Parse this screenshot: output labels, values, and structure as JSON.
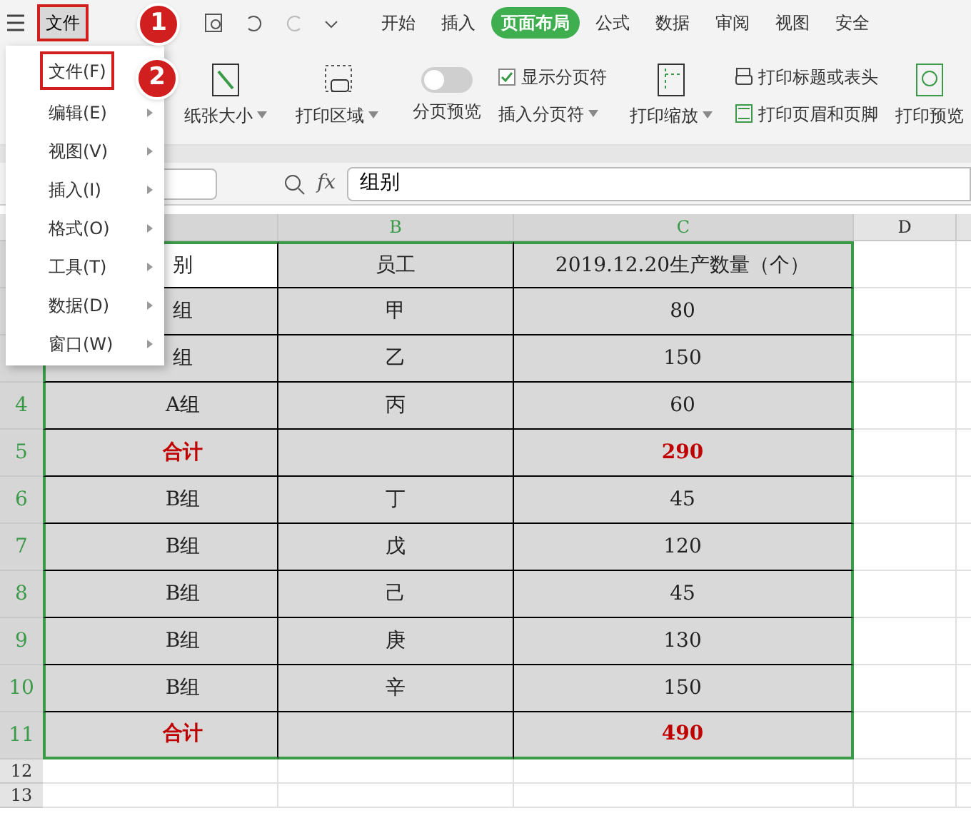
{
  "menu_bar": {
    "file_button": "文件",
    "tabs": [
      {
        "label": "开始",
        "selected": false
      },
      {
        "label": "插入",
        "selected": false
      },
      {
        "label": "页面布局",
        "selected": true
      },
      {
        "label": "公式",
        "selected": false
      },
      {
        "label": "数据",
        "selected": false
      },
      {
        "label": "审阅",
        "selected": false
      },
      {
        "label": "视图",
        "selected": false
      },
      {
        "label": "安全",
        "selected": false
      }
    ]
  },
  "ribbon": {
    "paper_size": "纸张大小",
    "print_area": "打印区域",
    "page_break_preview": {
      "label": "分页预览",
      "on": false
    },
    "show_page_breaks": {
      "label": "显示分页符",
      "checked": true
    },
    "insert_page_break": "插入分页符",
    "print_scaling": "打印缩放",
    "print_titles": "打印标题或表头",
    "print_header_footer": "打印页眉和页脚",
    "print_preview": "打印预览"
  },
  "formula_bar": {
    "fx": "fx",
    "value": "组别"
  },
  "columns": [
    "B",
    "C",
    "D"
  ],
  "rows": [
    {
      "number": "",
      "kind": "header",
      "cells": [
        "别",
        "员工",
        "2019.12.20生产数量（个）"
      ]
    },
    {
      "number": "",
      "kind": "data",
      "cells": [
        "组",
        "甲",
        "80"
      ]
    },
    {
      "number": "",
      "kind": "data",
      "cells": [
        "组",
        "乙",
        "150"
      ]
    },
    {
      "number": "4",
      "kind": "data",
      "cells": [
        "A组",
        "丙",
        "60"
      ]
    },
    {
      "number": "5",
      "kind": "total",
      "cells": [
        "合计",
        "",
        "290"
      ]
    },
    {
      "number": "6",
      "kind": "data",
      "cells": [
        "B组",
        "丁",
        "45"
      ]
    },
    {
      "number": "7",
      "kind": "data",
      "cells": [
        "B组",
        "戊",
        "120"
      ]
    },
    {
      "number": "8",
      "kind": "data",
      "cells": [
        "B组",
        "己",
        "45"
      ]
    },
    {
      "number": "9",
      "kind": "data",
      "cells": [
        "B组",
        "庚",
        "130"
      ]
    },
    {
      "number": "10",
      "kind": "data",
      "cells": [
        "B组",
        "辛",
        "150"
      ]
    },
    {
      "number": "11",
      "kind": "total",
      "cells": [
        "合计",
        "",
        "490"
      ]
    }
  ],
  "empty_rows": [
    "12",
    "13"
  ],
  "menu": [
    {
      "label": "文件(F)",
      "submenu": false
    },
    {
      "label": "编辑(E)",
      "submenu": true
    },
    {
      "label": "视图(V)",
      "submenu": true
    },
    {
      "label": "插入(I)",
      "submenu": true
    },
    {
      "label": "格式(O)",
      "submenu": true
    },
    {
      "label": "工具(T)",
      "submenu": true
    },
    {
      "label": "数据(D)",
      "submenu": true
    },
    {
      "label": "窗口(W)",
      "submenu": true
    }
  ],
  "annotations": [
    "1",
    "2"
  ]
}
